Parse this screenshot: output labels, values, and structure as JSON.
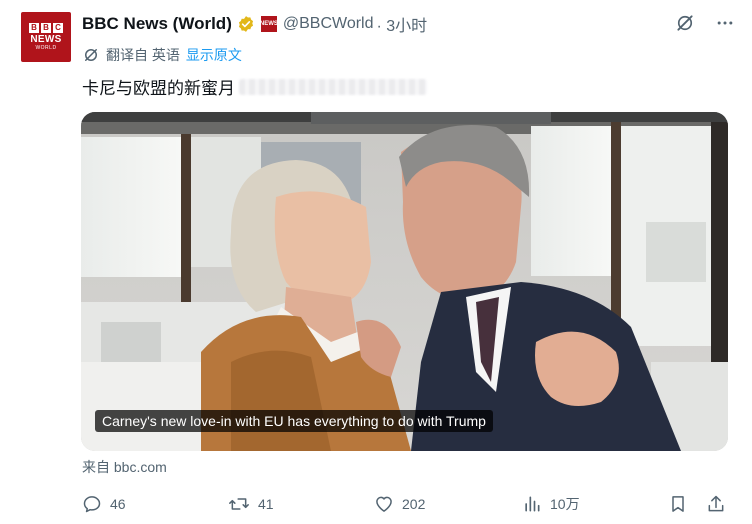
{
  "account": {
    "display_name": "BBC News (World)",
    "handle": "@BBCWorld",
    "time": "· 3小时",
    "avatar_text": {
      "blocks": [
        "B",
        "B",
        "C"
      ],
      "news": "NEWS",
      "world": "WORLD"
    },
    "org_badge_text": "NEWS"
  },
  "translation": {
    "label": "翻译自 英语",
    "show_original": "显示原文"
  },
  "tweet": {
    "text": "卡尼与欧盟的新蜜月"
  },
  "media": {
    "caption": "Carney's new love-in with EU has everything to do with Trump"
  },
  "link_source": "来自 bbc.com",
  "actions": {
    "replies": "46",
    "reposts": "41",
    "likes": "202",
    "views": "10万"
  },
  "colors": {
    "brand_red": "#b0141b",
    "link_blue": "#1d9bf0",
    "verified_gold": "#e2b719",
    "muted": "#536471"
  },
  "icons": [
    "translate-icon",
    "more-icon",
    "reply-icon",
    "repost-icon",
    "like-icon",
    "views-icon",
    "bookmark-icon",
    "share-icon",
    "verified-icon"
  ]
}
